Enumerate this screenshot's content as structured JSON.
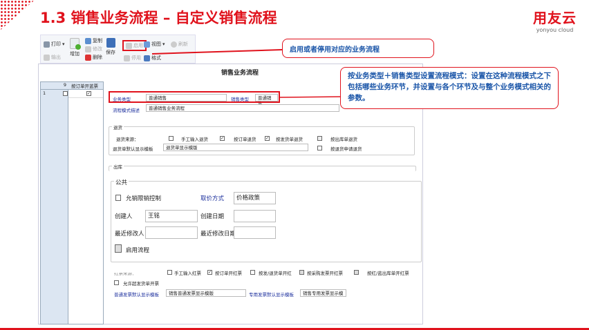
{
  "slide": {
    "title": "1.3 销售业务流程 – 自定义销售流程",
    "logo_main": "用友云",
    "logo_sub": "yonyou cloud"
  },
  "toolbar": {
    "print": "打印",
    "output": "输出",
    "add": "增加",
    "copy": "复制",
    "modify": "修改",
    "delete": "删除",
    "save": "保存",
    "enable": "启用",
    "disable": "停用",
    "view": "视图",
    "format": "格式",
    "refresh": "刷新"
  },
  "grid": {
    "header_sort": "9",
    "header_col": "按订单开蓝票",
    "row_num": "1"
  },
  "form": {
    "title": "销售业务流程",
    "biz_type_label": "业务类型",
    "biz_type_value": "普通销售",
    "sale_type_label": "销售类型",
    "sale_type_value": "普通销售",
    "desc_label": "流程模式描述",
    "desc_value": "普通销售业务流程",
    "returns": {
      "title": "退货",
      "source_label": "退货来源：",
      "opt_manual": "手工输入退货",
      "opt_order": "按订单退货",
      "opt_delivery": "按发货单退货",
      "opt_outbound": "按出库单退货",
      "template_label": "退货单默认显示模板",
      "template_value": "退货单显示模版",
      "opt_apply": "按退货申请退货"
    },
    "outbound": {
      "title": "出库"
    },
    "common": {
      "title": "公共",
      "allow_limit": "允销限销控制",
      "price_label": "取价方式",
      "price_value": "价格政策",
      "creator_label": "创建人",
      "creator_value": "王铭",
      "create_date_label": "创建日期",
      "modifier_label": "最近修改人",
      "modify_date_label": "最近修改日期",
      "enable_flow": "启用流程"
    },
    "invoice": {
      "partial_label": "红票来源：",
      "opt_manual": "手工输入红票",
      "opt_order": "按订单开红票",
      "opt_delivery": "按发/退货单开红",
      "opt_purchase": "按采购发票开红票",
      "opt_outbound": "按红/蓝出库单开红票",
      "allow_over": "允许超发货单开票",
      "normal_tpl_label": "普通发票默认显示模板",
      "normal_tpl_value": "销售普通发票显示模版",
      "special_tpl_label": "专用发票默认显示模板",
      "special_tpl_value": "销售专用发票显示模"
    }
  },
  "callouts": {
    "enable": "启用或者停用对应的业务流程",
    "mode": "按业务类型＋销售类型设置流程模式：设置在这种流程模式之下包括哪些业务环节，并设置与各个环节及与整个业务模式相关的参数。"
  },
  "colors": {
    "accent": "#e0121c",
    "label_blue": "#1a2d9c",
    "callout_text": "#1a55a8"
  }
}
